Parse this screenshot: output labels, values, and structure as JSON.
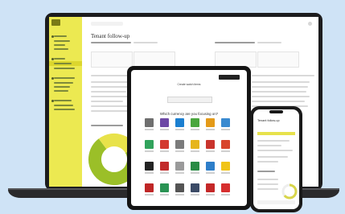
{
  "laptop": {
    "app_title": "Tenant follow-up",
    "sidebar_sections": [
      "section-1",
      "section-2",
      "section-3",
      "section-4"
    ]
  },
  "tablet": {
    "title": "Create watch items",
    "question": "Which currency are you focusing on?",
    "tile_colors": [
      "#6f6f6f",
      "#6d48a5",
      "#1b7fd0",
      "#4aa63e",
      "#e49a18",
      "#3a8ad0",
      "#31a35c",
      "#d3392f",
      "#7b7b7b",
      "#e6b51c",
      "#c9342c",
      "#d8452c",
      "#232323",
      "#c22b2b",
      "#9a9a9a",
      "#2a8b45",
      "#2d7ec9",
      "#f0c419",
      "#bf2626",
      "#2a9353",
      "#545454",
      "#3b4a66",
      "#c42727",
      "#d62e2e"
    ]
  },
  "phone": {
    "title": "Tenant follow-up"
  },
  "colors": {
    "sidebar": "#ece951",
    "donut_green": "#9bbf28",
    "donut_yellow": "#e8e24a",
    "phone_meter": "#d8d54a"
  }
}
